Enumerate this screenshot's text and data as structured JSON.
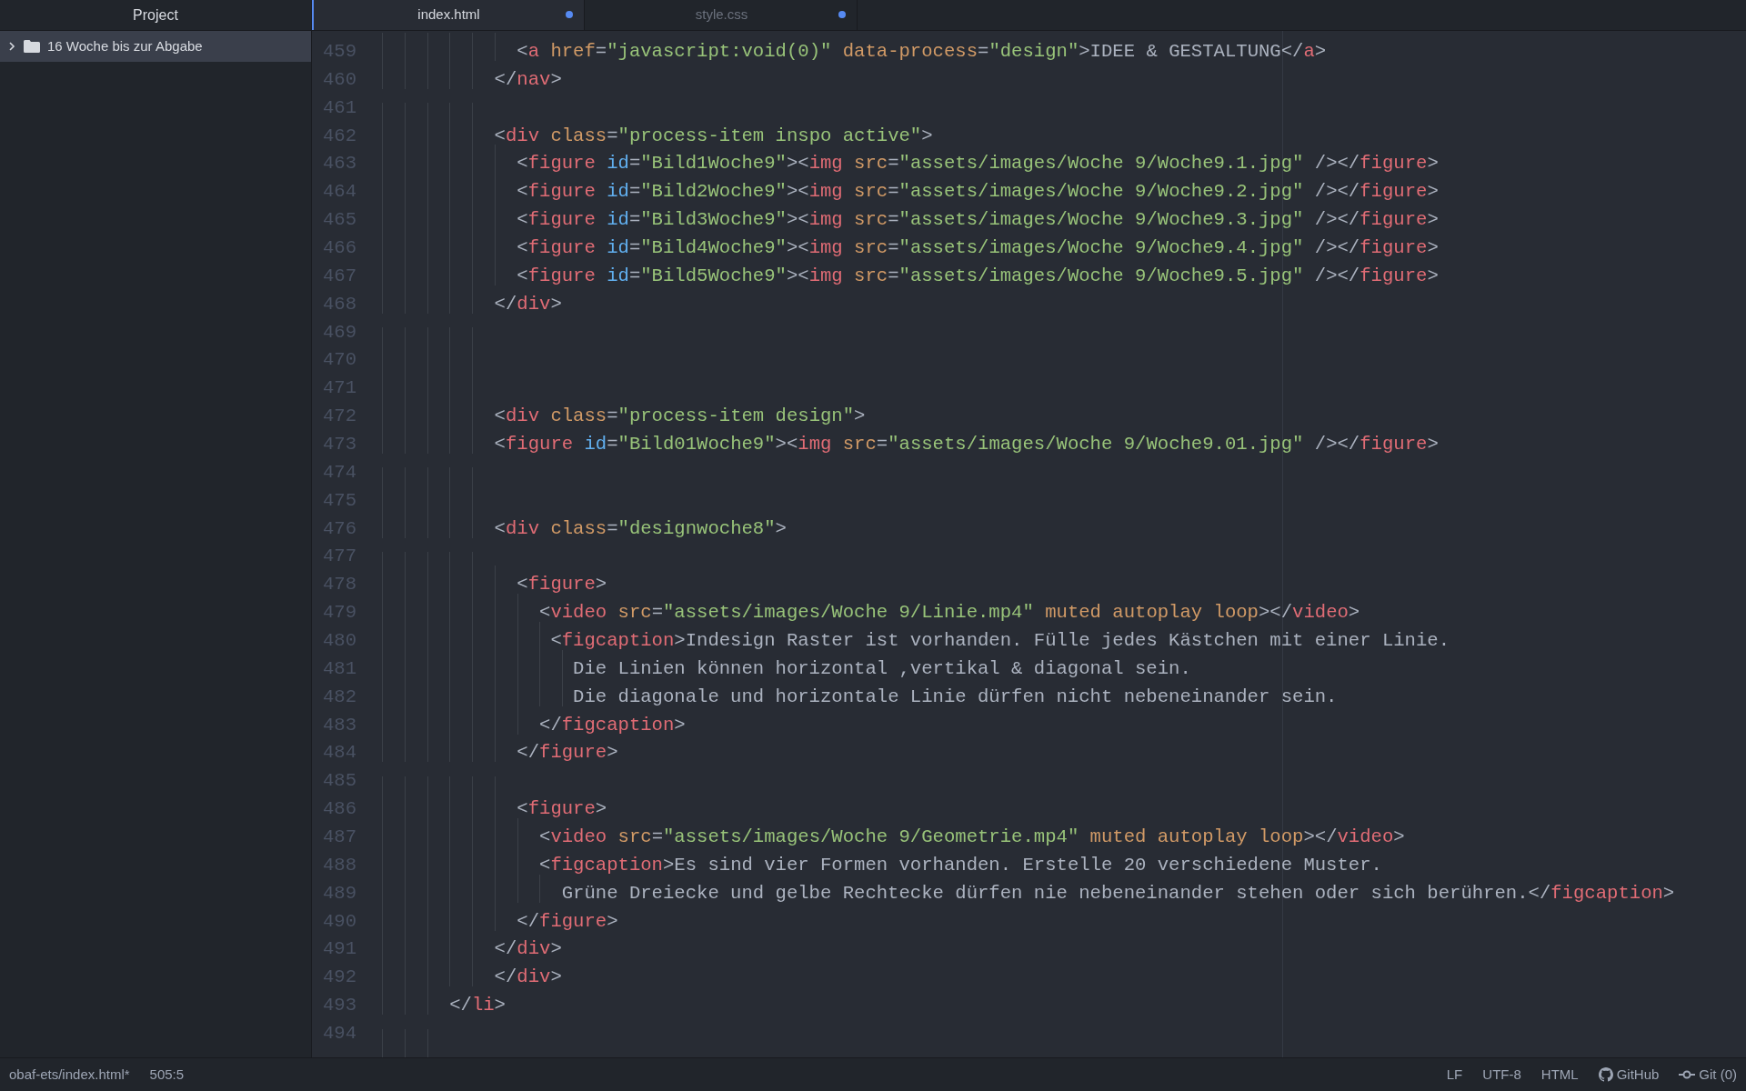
{
  "sidebar": {
    "title": "Project",
    "items": [
      {
        "label": "16 Woche bis zur Abgabe",
        "expanded": false,
        "selected": true
      }
    ]
  },
  "tabs": [
    {
      "label": "index.html",
      "selected": true,
      "modified": true
    },
    {
      "label": "style.css",
      "selected": false,
      "modified": true
    }
  ],
  "editor": {
    "lines": [
      {
        "number": "459",
        "tokens": [
          {
            "kind": "plain",
            "text": "            <"
          },
          {
            "kind": "tag",
            "text": "a"
          },
          {
            "kind": "attr",
            "text": " href"
          },
          {
            "kind": "plain",
            "text": "="
          },
          {
            "kind": "string",
            "text": "\"javascript:void(0)\""
          },
          {
            "kind": "attr",
            "text": " data-process"
          },
          {
            "kind": "plain",
            "text": "="
          },
          {
            "kind": "string",
            "text": "\"design\""
          },
          {
            "kind": "plain",
            "text": ">IDEE & GESTALTUNG</"
          },
          {
            "kind": "tag",
            "text": "a"
          },
          {
            "kind": "plain",
            "text": ">"
          }
        ]
      },
      {
        "number": "460",
        "tokens": [
          {
            "kind": "plain",
            "text": "          </"
          },
          {
            "kind": "tag",
            "text": "nav"
          },
          {
            "kind": "plain",
            "text": ">"
          }
        ]
      },
      {
        "number": "461"
      },
      {
        "number": "462",
        "tokens": [
          {
            "kind": "plain",
            "text": "          <"
          },
          {
            "kind": "tag",
            "text": "div"
          },
          {
            "kind": "attr",
            "text": " class"
          },
          {
            "kind": "plain",
            "text": "="
          },
          {
            "kind": "string",
            "text": "\"process-item inspo active\""
          },
          {
            "kind": "plain",
            "text": ">"
          }
        ]
      },
      {
        "number": "463",
        "tokens": [
          {
            "kind": "plain",
            "text": "            <"
          },
          {
            "kind": "tag",
            "text": "figure"
          },
          {
            "kind": "id",
            "text": " id"
          },
          {
            "kind": "plain",
            "text": "="
          },
          {
            "kind": "string",
            "text": "\"Bild1Woche9\""
          },
          {
            "kind": "plain",
            "text": "><"
          },
          {
            "kind": "tag",
            "text": "img"
          },
          {
            "kind": "attr",
            "text": " src"
          },
          {
            "kind": "plain",
            "text": "="
          },
          {
            "kind": "string",
            "text": "\"assets/images/Woche 9/Woche9.1.jpg\""
          },
          {
            "kind": "plain",
            "text": " /></"
          },
          {
            "kind": "tag",
            "text": "figure"
          },
          {
            "kind": "plain",
            "text": ">"
          }
        ]
      },
      {
        "number": "464",
        "tokens": [
          {
            "kind": "plain",
            "text": "            <"
          },
          {
            "kind": "tag",
            "text": "figure"
          },
          {
            "kind": "id",
            "text": " id"
          },
          {
            "kind": "plain",
            "text": "="
          },
          {
            "kind": "string",
            "text": "\"Bild2Woche9\""
          },
          {
            "kind": "plain",
            "text": "><"
          },
          {
            "kind": "tag",
            "text": "img"
          },
          {
            "kind": "attr",
            "text": " src"
          },
          {
            "kind": "plain",
            "text": "="
          },
          {
            "kind": "string",
            "text": "\"assets/images/Woche 9/Woche9.2.jpg\""
          },
          {
            "kind": "plain",
            "text": " /></"
          },
          {
            "kind": "tag",
            "text": "figure"
          },
          {
            "kind": "plain",
            "text": ">"
          }
        ]
      },
      {
        "number": "465",
        "tokens": [
          {
            "kind": "plain",
            "text": "            <"
          },
          {
            "kind": "tag",
            "text": "figure"
          },
          {
            "kind": "id",
            "text": " id"
          },
          {
            "kind": "plain",
            "text": "="
          },
          {
            "kind": "string",
            "text": "\"Bild3Woche9\""
          },
          {
            "kind": "plain",
            "text": "><"
          },
          {
            "kind": "tag",
            "text": "img"
          },
          {
            "kind": "attr",
            "text": " src"
          },
          {
            "kind": "plain",
            "text": "="
          },
          {
            "kind": "string",
            "text": "\"assets/images/Woche 9/Woche9.3.jpg\""
          },
          {
            "kind": "plain",
            "text": " /></"
          },
          {
            "kind": "tag",
            "text": "figure"
          },
          {
            "kind": "plain",
            "text": ">"
          }
        ]
      },
      {
        "number": "466",
        "tokens": [
          {
            "kind": "plain",
            "text": "            <"
          },
          {
            "kind": "tag",
            "text": "figure"
          },
          {
            "kind": "id",
            "text": " id"
          },
          {
            "kind": "plain",
            "text": "="
          },
          {
            "kind": "string",
            "text": "\"Bild4Woche9\""
          },
          {
            "kind": "plain",
            "text": "><"
          },
          {
            "kind": "tag",
            "text": "img"
          },
          {
            "kind": "attr",
            "text": " src"
          },
          {
            "kind": "plain",
            "text": "="
          },
          {
            "kind": "string",
            "text": "\"assets/images/Woche 9/Woche9.4.jpg\""
          },
          {
            "kind": "plain",
            "text": " /></"
          },
          {
            "kind": "tag",
            "text": "figure"
          },
          {
            "kind": "plain",
            "text": ">"
          }
        ]
      },
      {
        "number": "467",
        "tokens": [
          {
            "kind": "plain",
            "text": "            <"
          },
          {
            "kind": "tag",
            "text": "figure"
          },
          {
            "kind": "id",
            "text": " id"
          },
          {
            "kind": "plain",
            "text": "="
          },
          {
            "kind": "string",
            "text": "\"Bild5Woche9\""
          },
          {
            "kind": "plain",
            "text": "><"
          },
          {
            "kind": "tag",
            "text": "img"
          },
          {
            "kind": "attr",
            "text": " src"
          },
          {
            "kind": "plain",
            "text": "="
          },
          {
            "kind": "string",
            "text": "\"assets/images/Woche 9/Woche9.5.jpg\""
          },
          {
            "kind": "plain",
            "text": " /></"
          },
          {
            "kind": "tag",
            "text": "figure"
          },
          {
            "kind": "plain",
            "text": ">"
          }
        ]
      },
      {
        "number": "468",
        "tokens": [
          {
            "kind": "plain",
            "text": "          </"
          },
          {
            "kind": "tag",
            "text": "div"
          },
          {
            "kind": "plain",
            "text": ">"
          }
        ]
      },
      {
        "number": "469"
      },
      {
        "number": "470"
      },
      {
        "number": "471"
      },
      {
        "number": "472",
        "tokens": [
          {
            "kind": "plain",
            "text": "          <"
          },
          {
            "kind": "tag",
            "text": "div"
          },
          {
            "kind": "attr",
            "text": " class"
          },
          {
            "kind": "plain",
            "text": "="
          },
          {
            "kind": "string",
            "text": "\"process-item design\""
          },
          {
            "kind": "plain",
            "text": ">"
          }
        ]
      },
      {
        "number": "473",
        "tokens": [
          {
            "kind": "plain",
            "text": "          <"
          },
          {
            "kind": "tag",
            "text": "figure"
          },
          {
            "kind": "id",
            "text": " id"
          },
          {
            "kind": "plain",
            "text": "="
          },
          {
            "kind": "string",
            "text": "\"Bild01Woche9\""
          },
          {
            "kind": "plain",
            "text": "><"
          },
          {
            "kind": "tag",
            "text": "img"
          },
          {
            "kind": "attr",
            "text": " src"
          },
          {
            "kind": "plain",
            "text": "="
          },
          {
            "kind": "string",
            "text": "\"assets/images/Woche 9/Woche9.01.jpg\""
          },
          {
            "kind": "plain",
            "text": " /></"
          },
          {
            "kind": "tag",
            "text": "figure"
          },
          {
            "kind": "plain",
            "text": ">"
          }
        ]
      },
      {
        "number": "474"
      },
      {
        "number": "475"
      },
      {
        "number": "476",
        "tokens": [
          {
            "kind": "plain",
            "text": "          <"
          },
          {
            "kind": "tag",
            "text": "div"
          },
          {
            "kind": "attr",
            "text": " class"
          },
          {
            "kind": "plain",
            "text": "="
          },
          {
            "kind": "string",
            "text": "\"designwoche8\""
          },
          {
            "kind": "plain",
            "text": ">"
          }
        ]
      },
      {
        "number": "477"
      },
      {
        "number": "478",
        "tokens": [
          {
            "kind": "plain",
            "text": "            <"
          },
          {
            "kind": "tag",
            "text": "figure"
          },
          {
            "kind": "plain",
            "text": ">"
          }
        ]
      },
      {
        "number": "479",
        "tokens": [
          {
            "kind": "plain",
            "text": "              <"
          },
          {
            "kind": "tag",
            "text": "video"
          },
          {
            "kind": "attr",
            "text": " src"
          },
          {
            "kind": "plain",
            "text": "="
          },
          {
            "kind": "string",
            "text": "\"assets/images/Woche 9/Linie.mp4\""
          },
          {
            "kind": "attr",
            "text": " muted autoplay loop"
          },
          {
            "kind": "plain",
            "text": "></"
          },
          {
            "kind": "tag",
            "text": "video"
          },
          {
            "kind": "plain",
            "text": ">"
          }
        ]
      },
      {
        "number": "480",
        "tokens": [
          {
            "kind": "plain",
            "text": "               <"
          },
          {
            "kind": "tag",
            "text": "figcaption"
          },
          {
            "kind": "plain",
            "text": ">Indesign Raster ist vorhanden. Fülle jedes Kästchen mit einer Linie."
          }
        ]
      },
      {
        "number": "481",
        "tokens": [
          {
            "kind": "plain",
            "text": "                 Die Linien können horizontal ,vertikal & diagonal sein."
          }
        ]
      },
      {
        "number": "482",
        "tokens": [
          {
            "kind": "plain",
            "text": "                 Die diagonale und horizontale Linie dürfen nicht nebeneinander sein."
          }
        ]
      },
      {
        "number": "483",
        "tokens": [
          {
            "kind": "plain",
            "text": "              </"
          },
          {
            "kind": "tag",
            "text": "figcaption"
          },
          {
            "kind": "plain",
            "text": ">"
          }
        ]
      },
      {
        "number": "484",
        "tokens": [
          {
            "kind": "plain",
            "text": "            </"
          },
          {
            "kind": "tag",
            "text": "figure"
          },
          {
            "kind": "plain",
            "text": ">"
          }
        ]
      },
      {
        "number": "485"
      },
      {
        "number": "486",
        "tokens": [
          {
            "kind": "plain",
            "text": "            <"
          },
          {
            "kind": "tag",
            "text": "figure"
          },
          {
            "kind": "plain",
            "text": ">"
          }
        ]
      },
      {
        "number": "487",
        "tokens": [
          {
            "kind": "plain",
            "text": "              <"
          },
          {
            "kind": "tag",
            "text": "video"
          },
          {
            "kind": "attr",
            "text": " src"
          },
          {
            "kind": "plain",
            "text": "="
          },
          {
            "kind": "string",
            "text": "\"assets/images/Woche 9/Geometrie.mp4\""
          },
          {
            "kind": "attr",
            "text": " muted autoplay loop"
          },
          {
            "kind": "plain",
            "text": "></"
          },
          {
            "kind": "tag",
            "text": "video"
          },
          {
            "kind": "plain",
            "text": ">"
          }
        ]
      },
      {
        "number": "488",
        "tokens": [
          {
            "kind": "plain",
            "text": "              <"
          },
          {
            "kind": "tag",
            "text": "figcaption"
          },
          {
            "kind": "plain",
            "text": ">Es sind vier Formen vorhanden. Erstelle 20 verschiedene Muster."
          }
        ]
      },
      {
        "number": "489",
        "tokens": [
          {
            "kind": "plain",
            "text": "                Grüne Dreiecke und gelbe Rechtecke dürfen nie nebeneinander stehen oder sich berühren.</"
          },
          {
            "kind": "tag",
            "text": "figcaption"
          },
          {
            "kind": "plain",
            "text": ">"
          }
        ]
      },
      {
        "number": "490",
        "tokens": [
          {
            "kind": "plain",
            "text": "            </"
          },
          {
            "kind": "tag",
            "text": "figure"
          },
          {
            "kind": "plain",
            "text": ">"
          }
        ]
      },
      {
        "number": "491",
        "tokens": [
          {
            "kind": "plain",
            "text": "          </"
          },
          {
            "kind": "tag",
            "text": "div"
          },
          {
            "kind": "plain",
            "text": ">"
          }
        ]
      },
      {
        "number": "492",
        "tokens": [
          {
            "kind": "plain",
            "text": "          </"
          },
          {
            "kind": "tag",
            "text": "div"
          },
          {
            "kind": "plain",
            "text": ">"
          }
        ]
      },
      {
        "number": "493",
        "tokens": [
          {
            "kind": "plain",
            "text": "      </"
          },
          {
            "kind": "tag",
            "text": "li"
          },
          {
            "kind": "plain",
            "text": ">"
          }
        ]
      },
      {
        "number": "494"
      }
    ]
  },
  "status_bar": {
    "file": "obaf-ets/index.html*",
    "cursor": "505:5",
    "line_ending": "LF",
    "encoding": "UTF-8",
    "grammar": "HTML",
    "github": "GitHub",
    "git": "Git (0)"
  }
}
